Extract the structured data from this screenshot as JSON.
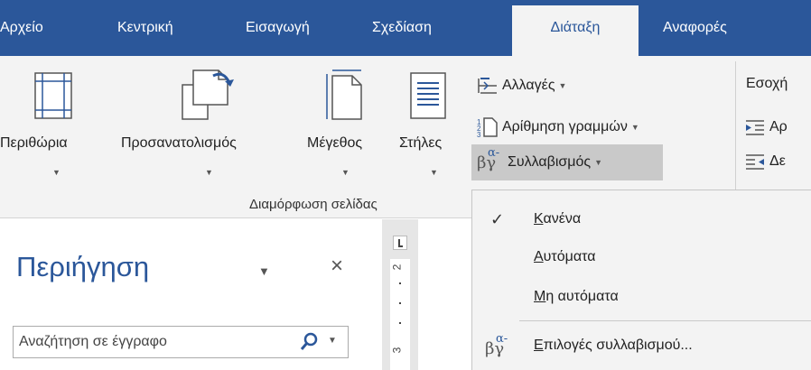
{
  "tabs": [
    {
      "label": "Αρχείο",
      "active": false
    },
    {
      "label": "Κεντρική",
      "active": false
    },
    {
      "label": "Εισαγωγή",
      "active": false
    },
    {
      "label": "Σχεδίαση",
      "active": false
    },
    {
      "label": "Διάταξη",
      "active": true
    },
    {
      "label": "Αναφορές",
      "active": false
    }
  ],
  "ribbon": {
    "margins_label": "Περιθώρια",
    "orientation_label": "Προσανατολισμός",
    "size_label": "Μέγεθος",
    "columns_label": "Στήλες",
    "breaks_label": "Αλλαγές",
    "line_numbers_label": "Αρίθμηση γραμμών",
    "hyphenation_label": "Συλλαβισμός",
    "hyphenation_icon_text": "βγ",
    "hyphenation_icon_sup": "α-",
    "group_label": "Διαμόρφωση σελίδας",
    "indent_label": "Εσοχή",
    "indent_left_partial": "Αρ",
    "indent_right_partial": "Δε"
  },
  "nav": {
    "title": "Περιήγηση",
    "close_glyph": "×",
    "search_placeholder": "Αναζήτηση σε έγγραφο"
  },
  "ruler": {
    "marks": [
      "2",
      "3"
    ]
  },
  "menu": {
    "check_glyph": "✓",
    "items": [
      {
        "underline": "Κ",
        "rest": "ανένα",
        "checked": true
      },
      {
        "underline": "Α",
        "rest": "υτόματα",
        "checked": false
      },
      {
        "underline": "Μ",
        "rest": "η αυτόματα",
        "checked": false
      },
      {
        "underline": "Ε",
        "rest": "πιλογές συλλαβισμού...",
        "checked": false
      }
    ]
  },
  "colors": {
    "accent": "#2b579a",
    "ribbon_bg": "#f3f3f3",
    "hover": "#c9c9c9"
  }
}
